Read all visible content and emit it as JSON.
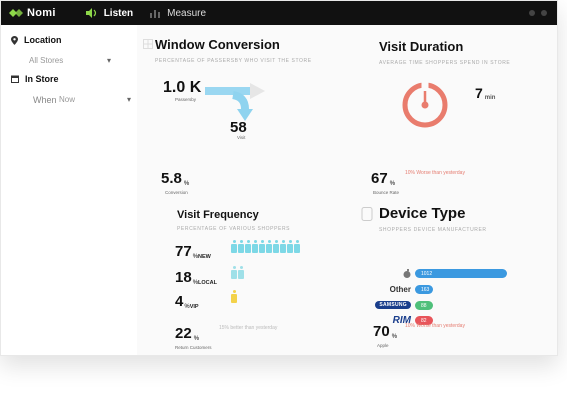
{
  "topbar": {
    "brand": "Nomi",
    "nav": [
      {
        "label": "Listen",
        "icon": "speaker-icon",
        "active": true
      },
      {
        "label": "Measure",
        "icon": "chart-icon",
        "active": false
      }
    ],
    "accent": "#8ed84a"
  },
  "sidebar": {
    "location_label": "Location",
    "location_value": "All Stores",
    "instore_label": "In Store",
    "when_label": "When",
    "when_value": "Now"
  },
  "window_conversion": {
    "title": "Window Conversion",
    "subtitle": "Percentage of passersby who visit the store",
    "passersby_value": "1.0 K",
    "passersby_caption": "Passersby",
    "visits_value": "58",
    "visits_caption": "Visit",
    "conversion_value": "5.8",
    "conversion_unit": "%",
    "conversion_caption": "Conversion",
    "arrow_color": "#8fd3ef"
  },
  "visit_duration": {
    "title": "Visit Duration",
    "subtitle": "Average time shoppers spend in store",
    "minutes_value": "7",
    "minutes_unit": "min",
    "bounce_value": "67",
    "bounce_unit": "%",
    "bounce_caption": "Bounce Rate",
    "faded_note": "10% Worse than yesterday",
    "ring_color": "#e97c6d"
  },
  "visit_frequency": {
    "title": "Visit Frequency",
    "subtitle": "Percentage of various shoppers",
    "rows": [
      {
        "value": "77",
        "unit": "%",
        "label": "NEW",
        "count": 10,
        "color": "#7dd8e6"
      },
      {
        "value": "18",
        "unit": "%",
        "label": "LOCAL",
        "count": 2,
        "color": "#9fe0e8"
      },
      {
        "value": "4",
        "unit": "%",
        "label": "VIP",
        "count": 1,
        "color": "#f3d24a"
      }
    ],
    "returning_value": "22",
    "returning_unit": "%",
    "returning_caption": "Return Customers",
    "faded_note": "15% better than yesterday"
  },
  "device_type": {
    "title": "Device Type",
    "subtitle": "Shoppers device manufacturer",
    "rows": [
      {
        "name": "",
        "logo": "apple-icon",
        "count": "1012",
        "fraction": 0.85,
        "color": "#3b99e0"
      },
      {
        "name": "Other",
        "logo": "",
        "count": "163",
        "fraction": 0.16,
        "color": "#3b99e0"
      },
      {
        "name": "SAMSUNG",
        "logo": "samsung-icon",
        "count": "88",
        "fraction": 0.12,
        "color": "#4fc07a"
      },
      {
        "name": "RIM",
        "logo": "rim-icon",
        "count": "82",
        "fraction": 0.11,
        "color": "#e8545a"
      }
    ],
    "apple_value": "70",
    "apple_unit": "%",
    "apple_caption": "Apple",
    "faded_note": "10% Worse than yesterday"
  }
}
